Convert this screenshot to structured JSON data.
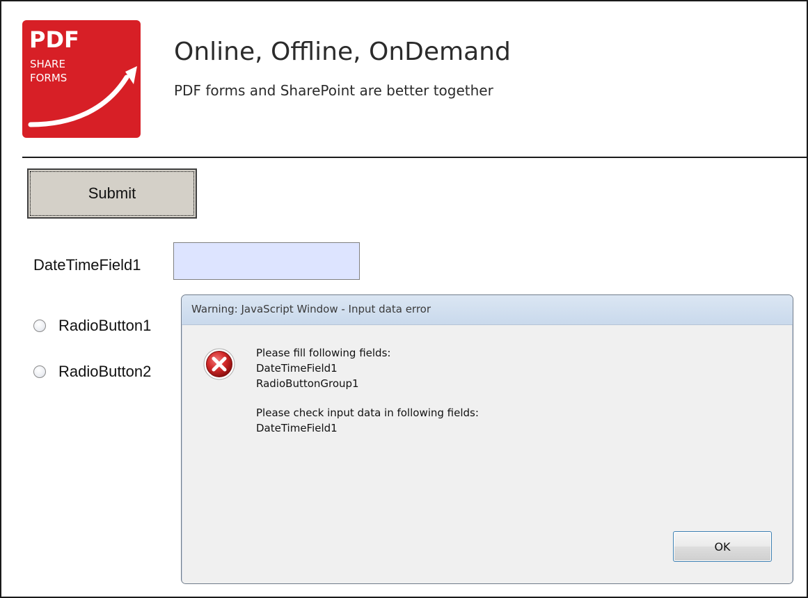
{
  "brand": {
    "logo_top": "PDF",
    "logo_middle": "SHARE",
    "logo_bottom": "FORMS",
    "color": "#d71f26"
  },
  "header": {
    "tagline": "Online, Offline, OnDemand",
    "subtagline": "PDF forms and SharePoint are better together"
  },
  "form": {
    "submit_label": "Submit",
    "date_field_label": "DateTimeField1",
    "date_field_value": "",
    "date_field_bg": "#dde4ff",
    "radios": [
      {
        "label": "RadioButton1",
        "selected": false
      },
      {
        "label": "RadioButton2",
        "selected": false
      }
    ]
  },
  "dialog": {
    "title": "Warning: JavaScript Window - Input data error",
    "icon": "error-icon",
    "message_lines_group1": [
      "Please fill following fields:",
      "DateTimeField1",
      "RadioButtonGroup1"
    ],
    "message_lines_group2": [
      "Please check input data in following fields:",
      "DateTimeField1"
    ],
    "ok_label": "OK"
  }
}
